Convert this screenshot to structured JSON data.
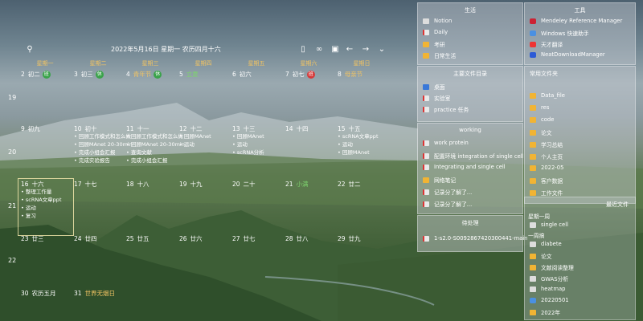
{
  "calendar": {
    "title": "2022年5月16日 星期一 农历四月十六",
    "weekdays": [
      "星期一",
      "星期二",
      "星期三",
      "星期四",
      "星期五",
      "星期六",
      "星期日"
    ],
    "weeks": [
      "19",
      "20",
      "21",
      "22"
    ],
    "row1": [
      {
        "d": "2",
        "l": "初二",
        "badge": "班"
      },
      {
        "d": "3",
        "l": "初三",
        "badge": "休"
      },
      {
        "d": "4",
        "l": "青年节",
        "badge": "休"
      },
      {
        "d": "5",
        "l": "立夏"
      },
      {
        "d": "6",
        "l": "初六"
      },
      {
        "d": "7",
        "l": "初七",
        "badge": "班"
      },
      {
        "d": "8",
        "l": "母亲节"
      }
    ],
    "row2": [
      {
        "d": "9",
        "l": "初九"
      },
      {
        "d": "10",
        "l": "初十"
      },
      {
        "d": "11",
        "l": "十一"
      },
      {
        "d": "12",
        "l": "十二"
      },
      {
        "d": "13",
        "l": "十三"
      },
      {
        "d": "14",
        "l": "十四"
      },
      {
        "d": "15",
        "l": "十五"
      }
    ],
    "row3": [
      {
        "d": "16",
        "l": "十六"
      },
      {
        "d": "17",
        "l": "十七"
      },
      {
        "d": "18",
        "l": "十八"
      },
      {
        "d": "19",
        "l": "十九"
      },
      {
        "d": "20",
        "l": "二十"
      },
      {
        "d": "21",
        "l": "小满"
      },
      {
        "d": "22",
        "l": "廿二"
      }
    ],
    "row4": [
      {
        "d": "23",
        "l": "廿三"
      },
      {
        "d": "24",
        "l": "廿四"
      },
      {
        "d": "25",
        "l": "廿五"
      },
      {
        "d": "26",
        "l": "廿六"
      },
      {
        "d": "27",
        "l": "廿七"
      },
      {
        "d": "28",
        "l": "廿八"
      },
      {
        "d": "29",
        "l": "廿九"
      }
    ],
    "row5": [
      {
        "d": "30",
        "l": "农历五月"
      },
      {
        "d": "31",
        "l": "世界无烟日"
      }
    ],
    "events_10": [
      "• 回顾工作模式和怎么做",
      "• 回顾MAnet 20-30min",
      "• 完成小组会汇报",
      "• 完成实验报告"
    ],
    "events_11": [
      "• 回顾工作模式和怎么做",
      "• 回顾MAnet 20-30min",
      "• 查询文献",
      "• 完成小组会汇报"
    ],
    "events_12": [
      "• 回顾MAnet",
      "• 运动"
    ],
    "events_13": [
      "• 回顾MAnet",
      "• 运动",
      "• scRNA分析"
    ],
    "events_15": [
      "• scRNA文章ppt",
      "• 运动",
      "• 回顾MAnet"
    ],
    "events_16": [
      "• 整理工作量",
      "• scRNA文章ppt",
      "• 运动",
      "• 复习"
    ]
  },
  "panels": {
    "life": {
      "title": "生活",
      "items": [
        "Notion",
        "Daily",
        "考研",
        "日常生活"
      ]
    },
    "tools": {
      "title": "工具",
      "items": [
        "Mendeley Reference Manager",
        "Windows 快速助手",
        "天才翻译",
        "NeatDownloadManager"
      ]
    },
    "home": {
      "title": "主要文件目录",
      "items": [
        "桌面",
        "实验室",
        "practice 任务"
      ]
    },
    "files": {
      "title": "常用文件夹",
      "items": [
        "Data_file",
        "res",
        "code",
        "论文",
        "学习总结",
        "个人主页",
        "2022-05",
        "客户数据",
        "工作文件"
      ]
    },
    "working": {
      "title": "working",
      "items": [
        "work protein",
        "配置环境 integration of single cell",
        "Integrating and single cell",
        "网络笔记",
        "记录分了解了...",
        "记录分了解了..."
      ]
    },
    "todo": {
      "title": "待处理",
      "items": [
        "1-s2.0-S0092867420300441-main"
      ]
    },
    "recent": {
      "title": "最近文件",
      "items": [
        "single cell",
        "diabete",
        "论文",
        "文献阅读整理",
        "GWAS分析",
        "heatmap",
        "20220501",
        "2022年"
      ]
    },
    "monday": {
      "title": "星期一周"
    },
    "weekly": {
      "title": "一周搞"
    }
  },
  "colors": {
    "accent": "#f2c463",
    "green": "#3aa34a",
    "red": "#d63a3a"
  }
}
